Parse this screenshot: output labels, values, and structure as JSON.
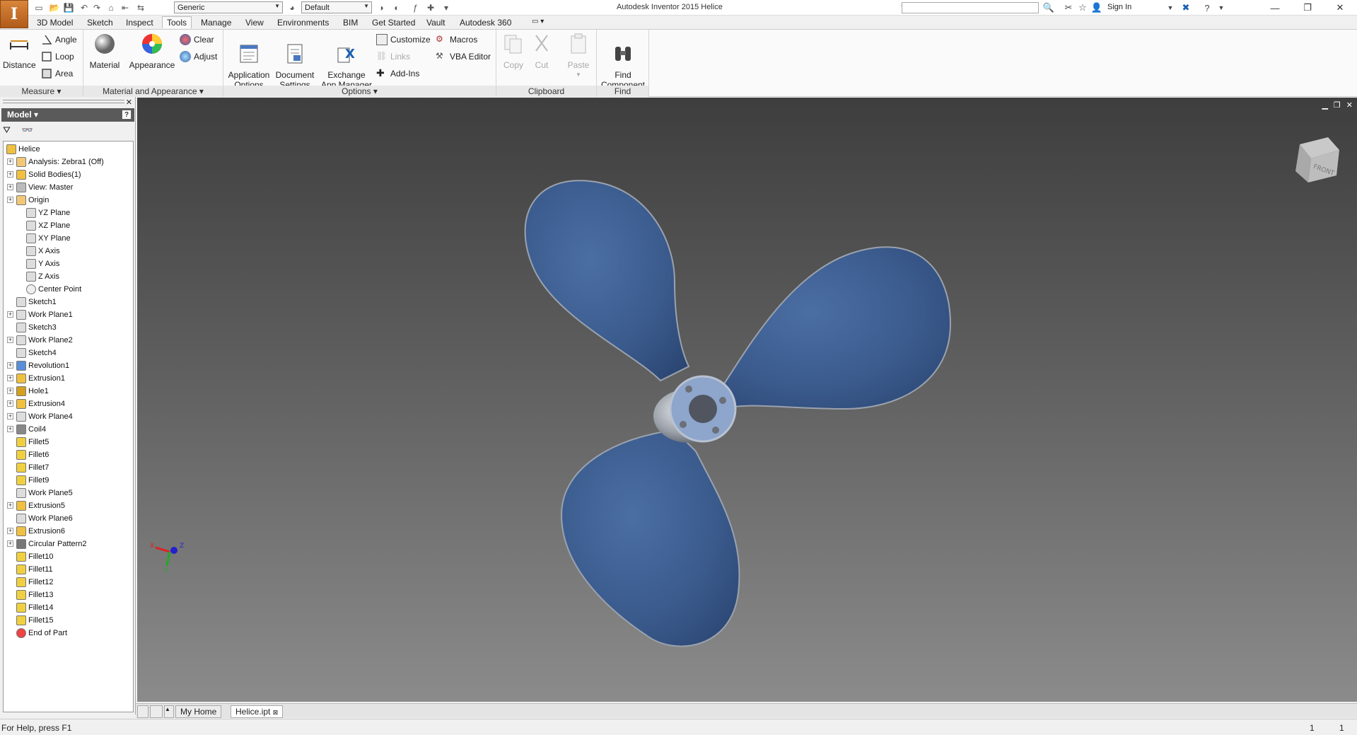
{
  "titlebar": {
    "app_button_label": "I",
    "material_combo": "Generic",
    "appearance_combo": "Default",
    "app_title": "Autodesk Inventor 2015   Helice",
    "search_placeholder": "",
    "sign_in": "Sign In"
  },
  "tabs": [
    "3D Model",
    "Sketch",
    "Inspect",
    "Tools",
    "Manage",
    "View",
    "Environments",
    "BIM",
    "Get Started",
    "Vault",
    "Autodesk 360"
  ],
  "active_tab": "Tools",
  "ribbon": {
    "measure": {
      "title": "Measure",
      "distance": "Distance",
      "angle": "Angle",
      "loop": "Loop",
      "area": "Area"
    },
    "material_appearance": {
      "title": "Material and Appearance",
      "material": "Material",
      "appearance": "Appearance",
      "clear": "Clear",
      "adjust": "Adjust"
    },
    "options": {
      "title": "Options",
      "app_options": "Application\nOptions",
      "doc_settings": "Document\nSettings",
      "exchange": "Exchange\nApp Manager",
      "customize": "Customize",
      "links": "Links",
      "addins": "Add-Ins",
      "macros": "Macros",
      "vba": "VBA Editor"
    },
    "clipboard": {
      "title": "Clipboard",
      "copy": "Copy",
      "cut": "Cut",
      "paste": "Paste"
    },
    "find": {
      "title": "Find",
      "find_component": "Find\nComponent"
    }
  },
  "browser": {
    "header": "Model",
    "help": "?",
    "tree": [
      {
        "label": "Helice",
        "level": 0,
        "exp": false,
        "icon": "part"
      },
      {
        "label": "Analysis: Zebra1 (Off)",
        "level": 1,
        "exp": true,
        "icon": "folder"
      },
      {
        "label": "Solid Bodies(1)",
        "level": 1,
        "exp": true,
        "icon": "solid"
      },
      {
        "label": "View: Master",
        "level": 1,
        "exp": true,
        "icon": "view"
      },
      {
        "label": "Origin",
        "level": 1,
        "exp": true,
        "icon": "folder-open"
      },
      {
        "label": "YZ Plane",
        "level": 2,
        "exp": false,
        "icon": "plane"
      },
      {
        "label": "XZ Plane",
        "level": 2,
        "exp": false,
        "icon": "plane"
      },
      {
        "label": "XY Plane",
        "level": 2,
        "exp": false,
        "icon": "plane"
      },
      {
        "label": "X Axis",
        "level": 2,
        "exp": false,
        "icon": "axis"
      },
      {
        "label": "Y Axis",
        "level": 2,
        "exp": false,
        "icon": "axis"
      },
      {
        "label": "Z Axis",
        "level": 2,
        "exp": false,
        "icon": "axis"
      },
      {
        "label": "Center Point",
        "level": 2,
        "exp": false,
        "icon": "point"
      },
      {
        "label": "Sketch1",
        "level": 1,
        "exp": false,
        "icon": "sketch"
      },
      {
        "label": "Work Plane1",
        "level": 1,
        "exp": true,
        "icon": "plane"
      },
      {
        "label": "Sketch3",
        "level": 1,
        "exp": false,
        "icon": "sketch"
      },
      {
        "label": "Work Plane2",
        "level": 1,
        "exp": true,
        "icon": "plane"
      },
      {
        "label": "Sketch4",
        "level": 1,
        "exp": false,
        "icon": "sketch"
      },
      {
        "label": "Revolution1",
        "level": 1,
        "exp": true,
        "icon": "revolve"
      },
      {
        "label": "Extrusion1",
        "level": 1,
        "exp": true,
        "icon": "extrude"
      },
      {
        "label": "Hole1",
        "level": 1,
        "exp": true,
        "icon": "hole"
      },
      {
        "label": "Extrusion4",
        "level": 1,
        "exp": true,
        "icon": "extrude"
      },
      {
        "label": "Work Plane4",
        "level": 1,
        "exp": true,
        "icon": "plane"
      },
      {
        "label": "Coil4",
        "level": 1,
        "exp": true,
        "icon": "coil"
      },
      {
        "label": "Fillet5",
        "level": 1,
        "exp": false,
        "icon": "fillet"
      },
      {
        "label": "Fillet6",
        "level": 1,
        "exp": false,
        "icon": "fillet"
      },
      {
        "label": "Fillet7",
        "level": 1,
        "exp": false,
        "icon": "fillet"
      },
      {
        "label": "Fillet9",
        "level": 1,
        "exp": false,
        "icon": "fillet"
      },
      {
        "label": "Work Plane5",
        "level": 1,
        "exp": false,
        "icon": "plane"
      },
      {
        "label": "Extrusion5",
        "level": 1,
        "exp": true,
        "icon": "extrude"
      },
      {
        "label": "Work Plane6",
        "level": 1,
        "exp": false,
        "icon": "plane"
      },
      {
        "label": "Extrusion6",
        "level": 1,
        "exp": true,
        "icon": "extrude"
      },
      {
        "label": "Circular Pattern2",
        "level": 1,
        "exp": true,
        "icon": "pattern"
      },
      {
        "label": "Fillet10",
        "level": 1,
        "exp": false,
        "icon": "fillet"
      },
      {
        "label": "Fillet11",
        "level": 1,
        "exp": false,
        "icon": "fillet"
      },
      {
        "label": "Fillet12",
        "level": 1,
        "exp": false,
        "icon": "fillet"
      },
      {
        "label": "Fillet13",
        "level": 1,
        "exp": false,
        "icon": "fillet"
      },
      {
        "label": "Fillet14",
        "level": 1,
        "exp": false,
        "icon": "fillet"
      },
      {
        "label": "Fillet15",
        "level": 1,
        "exp": false,
        "icon": "fillet"
      },
      {
        "label": "End of Part",
        "level": 1,
        "exp": false,
        "icon": "end"
      }
    ]
  },
  "viewcube_label": "FRONT",
  "axis_labels": {
    "x": "X",
    "y": "Y",
    "z": "Z"
  },
  "doc_tabs": {
    "home": "My Home",
    "file": "Helice.ipt"
  },
  "status": {
    "help": "For Help, press F1",
    "count1": "1",
    "count2": "1"
  },
  "colors": {
    "blade": "#3b5a8e",
    "hub": "#9aa0a8",
    "accent": "#c8701e"
  }
}
